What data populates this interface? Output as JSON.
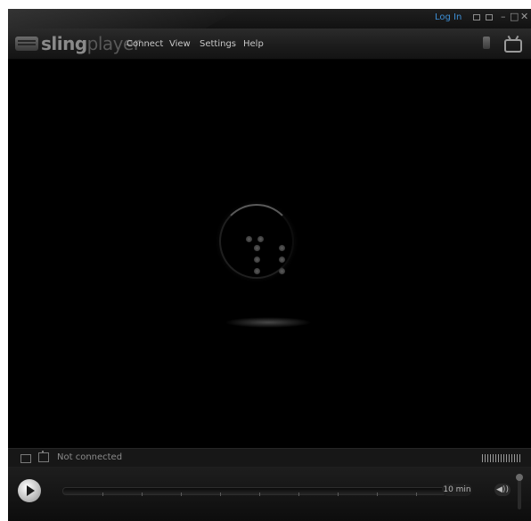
{
  "titlebar": {
    "login_label": "Log In",
    "window_controls": [
      "minimize-glyph",
      "restore-glyph",
      "close-glyph"
    ],
    "minimize_glyph": "–",
    "maximize_glyph": "□",
    "close_glyph": "✕"
  },
  "app": {
    "logo_part1": "sling",
    "logo_part2": "player"
  },
  "menu": {
    "items": [
      {
        "label": "Connect"
      },
      {
        "label": "View"
      },
      {
        "label": "Settings"
      },
      {
        "label": "Help"
      }
    ]
  },
  "status": {
    "text": "Not connected"
  },
  "controls": {
    "time_label": "10 min",
    "volume_glyph": "◀))"
  },
  "colors": {
    "accent": "#3d8fd6",
    "background": "#000000",
    "menu_text": "#c7c7c7"
  }
}
